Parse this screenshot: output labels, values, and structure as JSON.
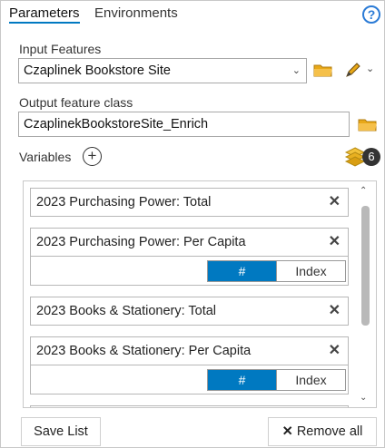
{
  "tabs": {
    "parameters": "Parameters",
    "environments": "Environments"
  },
  "help_icon": "?",
  "input_features": {
    "label": "Input Features",
    "value": "Czaplinek Bookstore Site"
  },
  "output_feature_class": {
    "label": "Output feature class",
    "value": "CzaplinekBookstoreSite_Enrich"
  },
  "variables": {
    "label": "Variables",
    "count": "6"
  },
  "variable_items": [
    {
      "name": "2023 Purchasing Power: Total"
    },
    {
      "name": "2023 Purchasing Power: Per Capita",
      "toggle_on": "#",
      "toggle_off": "Index"
    },
    {
      "name": "2023 Books & Stationery: Total"
    },
    {
      "name": "2023 Books & Stationery: Per Capita",
      "toggle_on": "#",
      "toggle_off": "Index"
    }
  ],
  "buttons": {
    "save_list": "Save List",
    "remove_all": "Remove all"
  },
  "colors": {
    "accent": "#0079c1",
    "folder": "#e8a818"
  }
}
